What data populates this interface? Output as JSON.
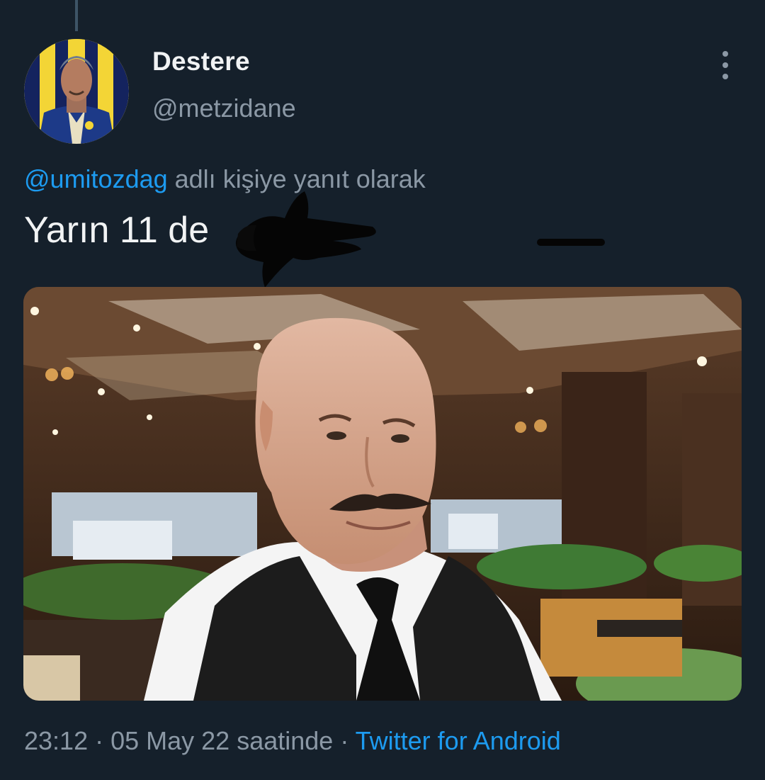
{
  "tweet": {
    "display_name": "Destere",
    "handle": "@metzidane",
    "reply_mention": "@umitozdag",
    "reply_suffix": " adlı kişiye yanıt olarak",
    "text": "Yarın 11 de",
    "time": "23:12",
    "separator": " · ",
    "date": "05 May 22 saatinde",
    "source": "Twitter for Android"
  },
  "icons": {
    "more": "more-vertical-icon",
    "avatar": "profile-avatar",
    "media": "attached-photo"
  },
  "colors": {
    "background": "#15202b",
    "primary_text": "#f1f3f4",
    "secondary_text": "#8b98a5",
    "link": "#1d9bf0"
  }
}
